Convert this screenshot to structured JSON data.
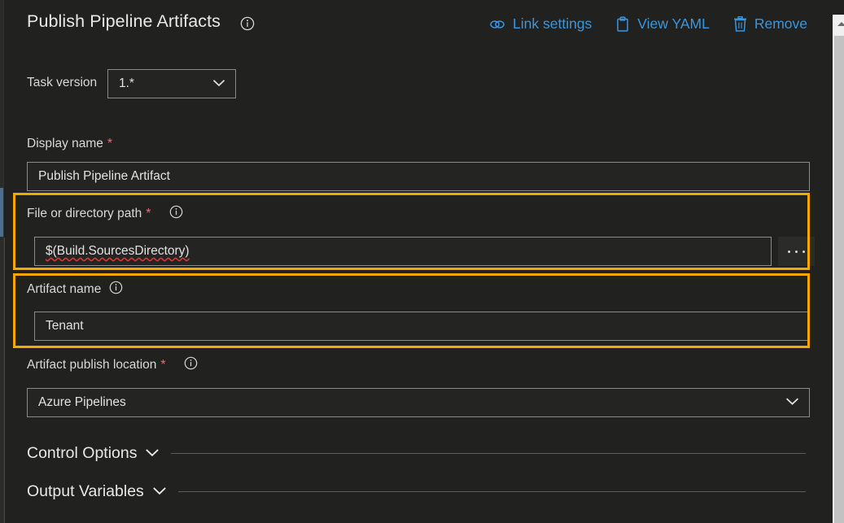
{
  "header": {
    "title": "Publish Pipeline Artifacts",
    "info_icon": "info-icon",
    "toolbar": [
      {
        "label": "Link settings",
        "icon": "link-icon"
      },
      {
        "label": "View YAML",
        "icon": "clipboard-icon"
      },
      {
        "label": "Remove",
        "icon": "trash-icon"
      }
    ]
  },
  "form": {
    "task_version": {
      "label": "Task version",
      "value": "1.*",
      "chevron": "chevron-down-icon"
    },
    "display_name": {
      "label": "Display name",
      "required": "*",
      "value": "Publish Pipeline Artifact"
    },
    "file_or_directory_path": {
      "label": "File or directory path",
      "required": "*",
      "info_icon": "info-icon",
      "value": "$(Build.SourcesDirectory)",
      "browse_button": "...",
      "highlighted": true
    },
    "artifact_name": {
      "label": "Artifact name",
      "info_icon": "info-icon",
      "value": "Tenant",
      "highlighted": true
    },
    "artifact_publish_location": {
      "label": "Artifact publish location",
      "required": "*",
      "info_icon": "info-icon",
      "value": "Azure Pipelines",
      "chevron": "chevron-down-icon"
    }
  },
  "sections": [
    {
      "label": "Control Options",
      "chevron": "chevron-down-icon"
    },
    {
      "label": "Output Variables",
      "chevron": "chevron-down-icon"
    }
  ],
  "scrollbar": {
    "up_arrow": "scroll-up-arrow-icon"
  },
  "colors": {
    "background": "#212120",
    "accent_link": "#3a96dd",
    "highlight": "#f5a800",
    "required_asterisk": "#e5707f",
    "field_border": "#8b8b8b",
    "text_primary": "#e8e8e8"
  }
}
